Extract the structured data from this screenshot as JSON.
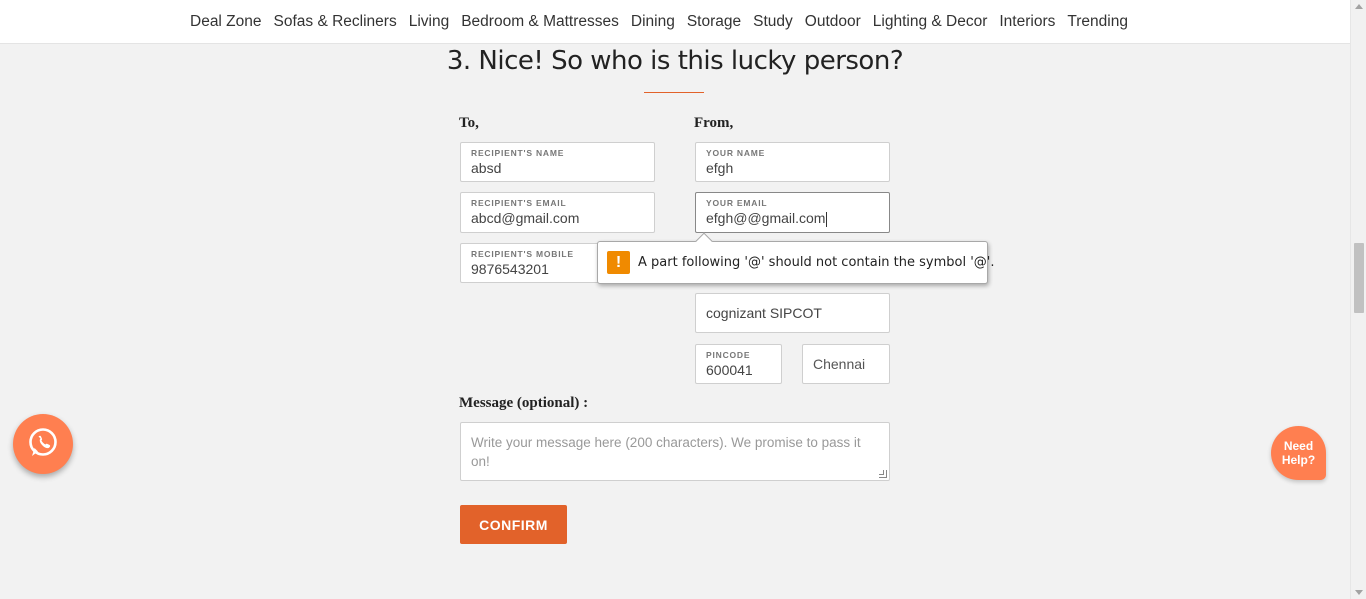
{
  "nav": {
    "items": [
      "Deal Zone",
      "Sofas & Recliners",
      "Living",
      "Bedroom & Mattresses",
      "Dining",
      "Storage",
      "Study",
      "Outdoor",
      "Lighting & Decor",
      "Interiors",
      "Trending"
    ]
  },
  "section": {
    "title": "3. Nice! So who is this lucky person?"
  },
  "to": {
    "heading": "To,",
    "name_label": "RECIPIENT'S NAME",
    "name_value": "absd",
    "email_label": "RECIPIENT'S EMAIL",
    "email_value": "abcd@gmail.com",
    "mobile_label": "RECIPIENT'S MOBILE",
    "mobile_value": "9876543201"
  },
  "from": {
    "heading": "From,",
    "name_label": "YOUR NAME",
    "name_value": "efgh",
    "email_label": "YOUR EMAIL",
    "email_value": "efgh@@gmail.com",
    "address_value": "cognizant SIPCOT",
    "pincode_label": "PINCODE",
    "pincode_value": "600041",
    "city_value": "Chennai"
  },
  "validation": {
    "icon": "warning-icon",
    "message": "A part following '@' should not contain the symbol '@'."
  },
  "message": {
    "label": "Message (optional) :",
    "placeholder": "Write your message here (200 characters). We promise to pass it on!"
  },
  "confirm_label": "CONFIRM",
  "help": {
    "whatsapp_icon": "whatsapp-icon",
    "need_help_line1": "Need",
    "need_help_line2": "Help?"
  },
  "colors": {
    "accent": "#e2622a",
    "floating": "#ff7f50",
    "warning": "#f08a00",
    "background": "#f2f2f2"
  }
}
